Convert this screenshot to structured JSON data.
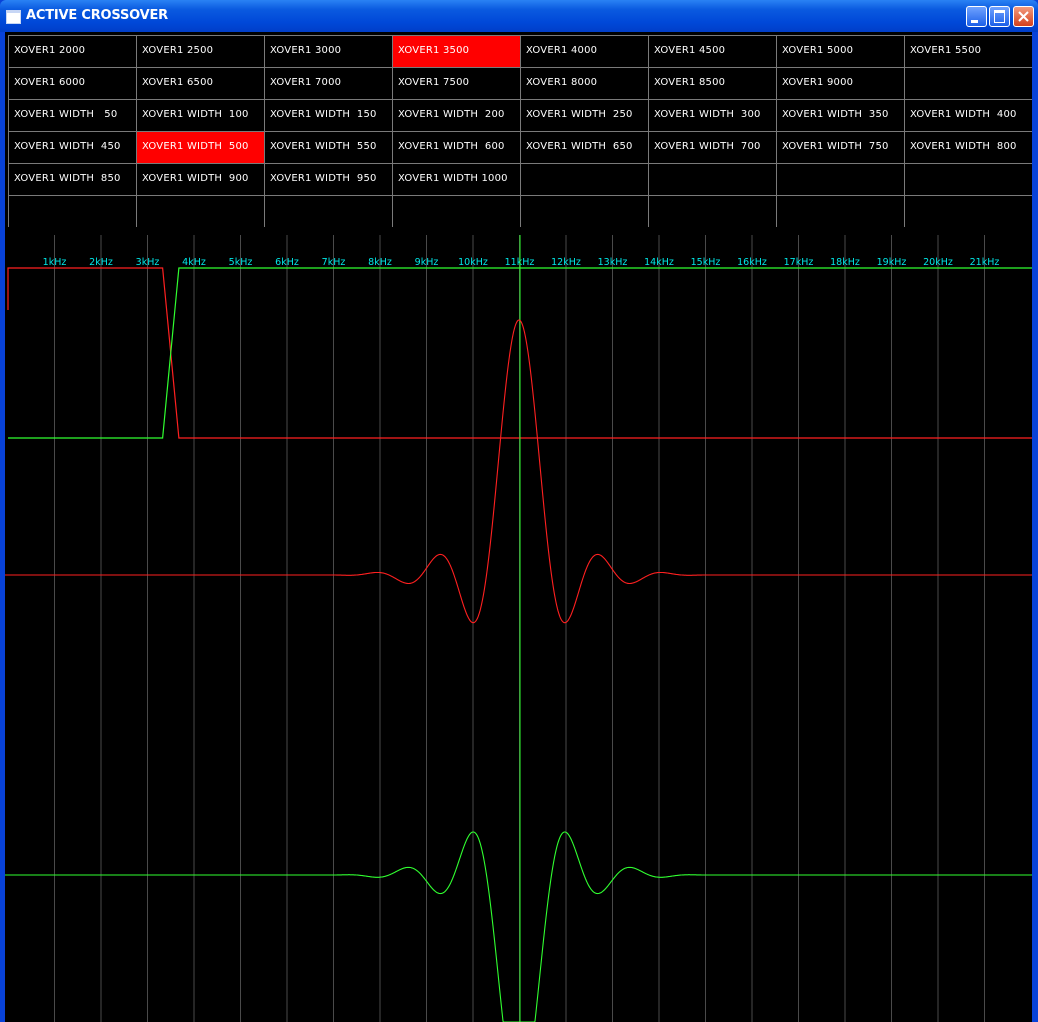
{
  "window": {
    "title": "ACTIVE CROSSOVER"
  },
  "colors": {
    "selected": "#ff0000",
    "trace_low": "#ff2020",
    "trace_high": "#30ff30",
    "freq_label": "#00e8e8",
    "grid": "#4a4a4a"
  },
  "grid": {
    "cells": [
      {
        "label": "XOVER1 2000",
        "selected": false
      },
      {
        "label": "XOVER1 2500",
        "selected": false
      },
      {
        "label": "XOVER1 3000",
        "selected": false
      },
      {
        "label": "XOVER1 3500",
        "selected": true
      },
      {
        "label": "XOVER1 4000",
        "selected": false
      },
      {
        "label": "XOVER1 4500",
        "selected": false
      },
      {
        "label": "XOVER1 5000",
        "selected": false
      },
      {
        "label": "XOVER1 5500",
        "selected": false
      },
      {
        "label": "XOVER1 6000",
        "selected": false
      },
      {
        "label": "XOVER1 6500",
        "selected": false
      },
      {
        "label": "XOVER1 7000",
        "selected": false
      },
      {
        "label": "XOVER1 7500",
        "selected": false
      },
      {
        "label": "XOVER1 8000",
        "selected": false
      },
      {
        "label": "XOVER1 8500",
        "selected": false
      },
      {
        "label": "XOVER1 9000",
        "selected": false
      },
      {
        "label": "",
        "selected": false
      },
      {
        "label": "XOVER1 WIDTH   50",
        "selected": false
      },
      {
        "label": "XOVER1 WIDTH  100",
        "selected": false
      },
      {
        "label": "XOVER1 WIDTH  150",
        "selected": false
      },
      {
        "label": "XOVER1 WIDTH  200",
        "selected": false
      },
      {
        "label": "XOVER1 WIDTH  250",
        "selected": false
      },
      {
        "label": "XOVER1 WIDTH  300",
        "selected": false
      },
      {
        "label": "XOVER1 WIDTH  350",
        "selected": false
      },
      {
        "label": "XOVER1 WIDTH  400",
        "selected": false
      },
      {
        "label": "XOVER1 WIDTH  450",
        "selected": false
      },
      {
        "label": "XOVER1 WIDTH  500",
        "selected": true
      },
      {
        "label": "XOVER1 WIDTH  550",
        "selected": false
      },
      {
        "label": "XOVER1 WIDTH  600",
        "selected": false
      },
      {
        "label": "XOVER1 WIDTH  650",
        "selected": false
      },
      {
        "label": "XOVER1 WIDTH  700",
        "selected": false
      },
      {
        "label": "XOVER1 WIDTH  750",
        "selected": false
      },
      {
        "label": "XOVER1 WIDTH  800",
        "selected": false
      },
      {
        "label": "XOVER1 WIDTH  850",
        "selected": false
      },
      {
        "label": "XOVER1 WIDTH  900",
        "selected": false
      },
      {
        "label": "XOVER1 WIDTH  950",
        "selected": false
      },
      {
        "label": "XOVER1 WIDTH 1000",
        "selected": false
      },
      {
        "label": "",
        "selected": false
      },
      {
        "label": "",
        "selected": false
      },
      {
        "label": "",
        "selected": false
      },
      {
        "label": "",
        "selected": false
      },
      {
        "label": "",
        "selected": false
      },
      {
        "label": "",
        "selected": false
      },
      {
        "label": "",
        "selected": false
      },
      {
        "label": "",
        "selected": false
      },
      {
        "label": "",
        "selected": false
      },
      {
        "label": "",
        "selected": false
      },
      {
        "label": "",
        "selected": false
      },
      {
        "label": "",
        "selected": false
      }
    ]
  },
  "plot": {
    "freq_labels": [
      "1kHz",
      "2kHz",
      "3kHz",
      "4kHz",
      "5kHz",
      "6kHz",
      "7kHz",
      "8kHz",
      "9kHz",
      "10kHz",
      "11kHz",
      "12kHz",
      "13kHz",
      "14kHz",
      "15kHz",
      "16kHz",
      "17kHz",
      "18kHz",
      "19kHz",
      "20kHz",
      "21kHz"
    ],
    "crossover_hz": 3500,
    "width_hz": 500
  }
}
